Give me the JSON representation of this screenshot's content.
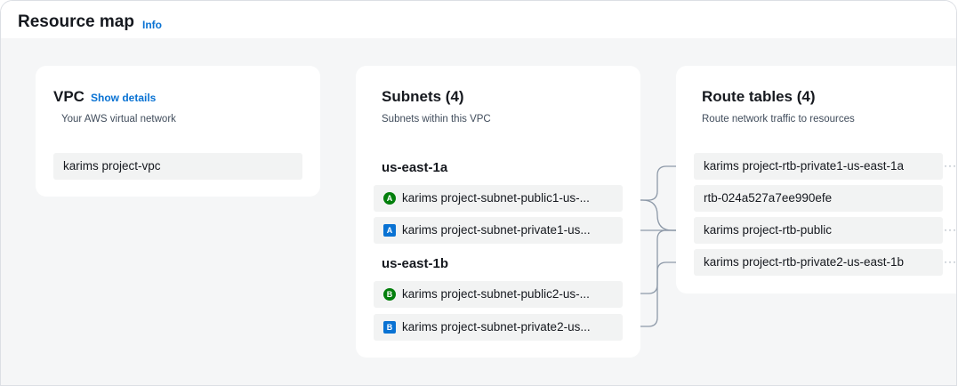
{
  "header": {
    "title": "Resource map",
    "info_label": "Info"
  },
  "vpc": {
    "title": "VPC",
    "show_details": "Show details",
    "subtitle": "Your AWS virtual network",
    "item": "karims project-vpc"
  },
  "subnets": {
    "title": "Subnets (4)",
    "subtitle": "Subnets within this VPC",
    "groups": [
      {
        "az": "us-east-1a",
        "items": [
          {
            "badge": "A",
            "type": "public",
            "label": "karims project-subnet-public1-us-..."
          },
          {
            "badge": "A",
            "type": "private",
            "label": "karims project-subnet-private1-us..."
          }
        ]
      },
      {
        "az": "us-east-1b",
        "items": [
          {
            "badge": "B",
            "type": "public",
            "label": "karims project-subnet-public2-us-..."
          },
          {
            "badge": "B",
            "type": "private",
            "label": "karims project-subnet-private2-us..."
          }
        ]
      }
    ]
  },
  "route_tables": {
    "title": "Route tables (4)",
    "subtitle": "Route network traffic to resources",
    "items": [
      "karims project-rtb-private1-us-east-1a",
      "rtb-024a527a7ee990efe",
      "karims project-rtb-public",
      "karims project-rtb-private2-us-east-1b"
    ]
  },
  "colors": {
    "link": "#0972d3",
    "public_badge": "#037f0c",
    "private_badge": "#0972d3",
    "connector": "#8d99a8"
  }
}
